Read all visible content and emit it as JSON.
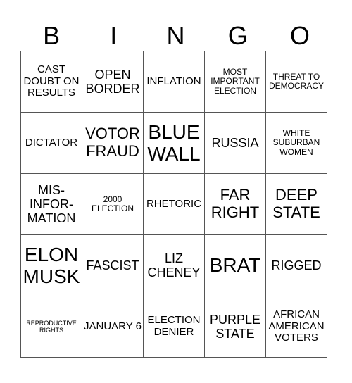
{
  "header": [
    "B",
    "I",
    "N",
    "G",
    "O"
  ],
  "rows": [
    [
      {
        "text": "CAST DOUBT ON RESULTS",
        "size": "md"
      },
      {
        "text": "OPEN BORDER",
        "size": "lg"
      },
      {
        "text": "INFLATION",
        "size": "md"
      },
      {
        "text": "MOST IMPORTANT ELECTION",
        "size": "sm"
      },
      {
        "text": "THREAT TO DEMOCRACY",
        "size": "sm"
      }
    ],
    [
      {
        "text": "DICTATOR",
        "size": "md"
      },
      {
        "text": "VOTOR FRAUD",
        "size": "xl"
      },
      {
        "text": "BLUE WALL",
        "size": "xxl"
      },
      {
        "text": "RUSSIA",
        "size": "lg"
      },
      {
        "text": "WHITE SUBURBAN WOMEN",
        "size": "sm"
      }
    ],
    [
      {
        "text": "MIS-INFOR-MATION",
        "size": "lg"
      },
      {
        "text": "2000 ELECTION",
        "size": "sm"
      },
      {
        "text": "RHETORIC",
        "size": "md"
      },
      {
        "text": "FAR RIGHT",
        "size": "xl"
      },
      {
        "text": "DEEP STATE",
        "size": "xl"
      }
    ],
    [
      {
        "text": "ELON MUSK",
        "size": "xxl"
      },
      {
        "text": "FASCIST",
        "size": "lg"
      },
      {
        "text": "LIZ CHENEY",
        "size": "lg"
      },
      {
        "text": "BRAT",
        "size": "xxl"
      },
      {
        "text": "RIGGED",
        "size": "lg"
      }
    ],
    [
      {
        "text": "REPRODUCTIVE RIGHTS",
        "size": "xs"
      },
      {
        "text": "JANUARY 6",
        "size": "md"
      },
      {
        "text": "ELECTION DENIER",
        "size": "md"
      },
      {
        "text": "PURPLE STATE",
        "size": "lg"
      },
      {
        "text": "AFRICAN AMERICAN VOTERS",
        "size": "md"
      }
    ]
  ]
}
